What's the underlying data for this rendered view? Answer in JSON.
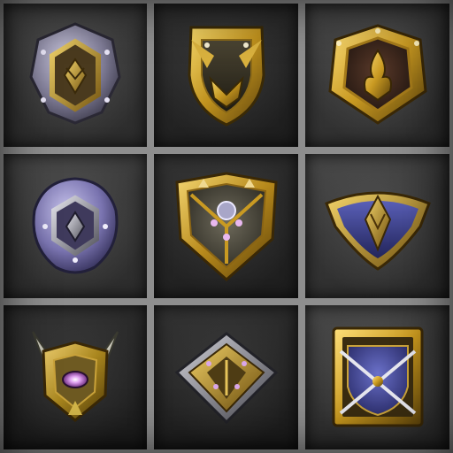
{
  "palette": {
    "gold": "#c8a12e",
    "gold_light": "#f1d36a",
    "gold_dark": "#6e5212",
    "steel": "#8f8f9a",
    "steel_dark": "#4d4d58",
    "violet": "#8c86b8",
    "navy": "#3b3f8c",
    "gem_purple": "#d9a6e8",
    "frame": "#8e8e8e"
  },
  "badges": [
    {
      "slot": 1,
      "shape": "round-shield",
      "material": "steel-gold",
      "icon": "diamond-emblem-icon"
    },
    {
      "slot": 2,
      "shape": "heater-shield",
      "material": "gold-dark",
      "icon": "chevron-emblem-icon"
    },
    {
      "slot": 3,
      "shape": "hex-shield",
      "material": "gold-gem",
      "icon": "flame-emblem-icon"
    },
    {
      "slot": 4,
      "shape": "round-shield",
      "material": "violet-steel",
      "icon": "diamond-emblem-icon"
    },
    {
      "slot": 5,
      "shape": "ornate-shield",
      "material": "gold-stone",
      "icon": "gem-cluster-icon"
    },
    {
      "slot": 6,
      "shape": "kite-shield",
      "material": "navy-gold",
      "icon": "arrowhead-emblem-icon"
    },
    {
      "slot": 7,
      "shape": "horned-shield",
      "material": "gold-gem",
      "icon": "eye-gem-icon"
    },
    {
      "slot": 8,
      "shape": "diamond-shield",
      "material": "steel-gold",
      "icon": "studded-diamond-icon"
    },
    {
      "slot": 9,
      "shape": "square-shield",
      "material": "navy-gold",
      "icon": "crossed-blades-icon"
    }
  ]
}
